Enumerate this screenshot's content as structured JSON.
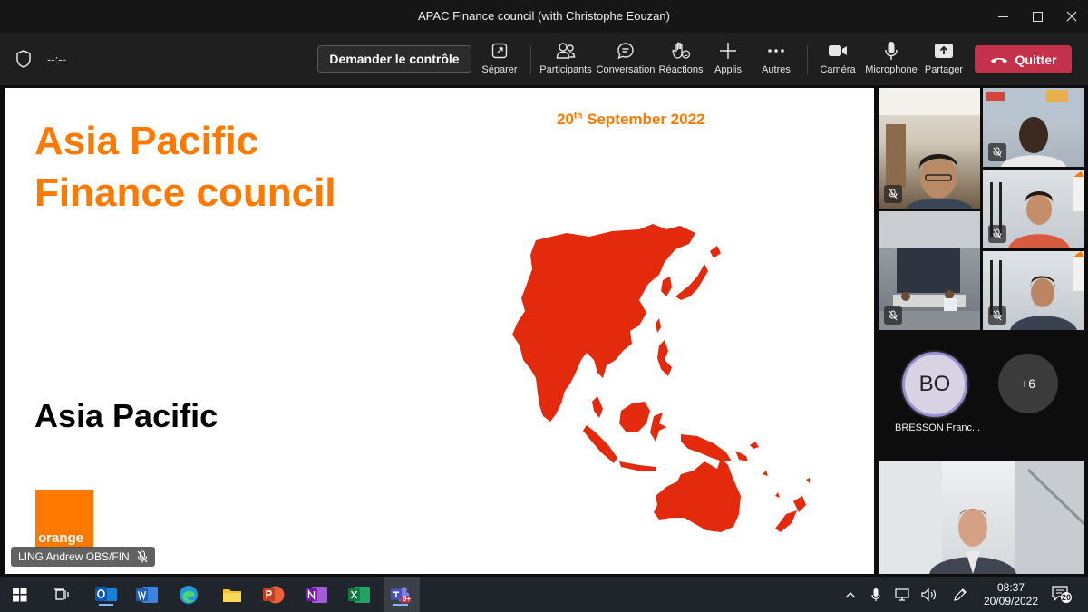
{
  "window": {
    "title": "APAC Finance council (with Christophe Eouzan)"
  },
  "toolbar": {
    "timer": "--:--",
    "control_label": "Demander le contrôle",
    "items": [
      {
        "label": "Séparer",
        "icon": "popout-icon"
      },
      {
        "label": "Participants",
        "icon": "people-icon"
      },
      {
        "label": "Conversation",
        "icon": "chat-icon"
      },
      {
        "label": "Réactions",
        "icon": "raise-hand-icon"
      },
      {
        "label": "Applis",
        "icon": "plus-icon"
      },
      {
        "label": "Autres",
        "icon": "more-icon"
      },
      {
        "label": "Caméra",
        "icon": "camera-icon"
      },
      {
        "label": "Microphone",
        "icon": "microphone-icon"
      },
      {
        "label": "Partager",
        "icon": "share-icon"
      }
    ],
    "quit_label": "Quitter",
    "quit_color": "#c4314b"
  },
  "slide": {
    "title_line1": "Asia Pacific",
    "title_line2": "Finance council",
    "date_day": "20",
    "date_suffix": "th",
    "date_rest": " September 2022",
    "subtitle": "Asia Pacific",
    "logo_text": "orange",
    "accent": "#ff7900",
    "map_color": "#e32a0c"
  },
  "presenter": {
    "name": "LING Andrew OBS/FIN"
  },
  "participants": {
    "avatar_initials": "BO",
    "avatar_name": "BRESSON Franc...",
    "more_count": "+6"
  },
  "taskbar": {
    "apps": [
      "windows-start-icon",
      "task-view-icon",
      "outlook-icon",
      "word-icon",
      "edge-icon",
      "file-explorer-icon",
      "powerpoint-icon",
      "onenote-icon",
      "excel-icon",
      "teams-icon"
    ],
    "teams_badge": "9+",
    "time": "08:37",
    "date": "20/09/2022",
    "notification_count": "20"
  }
}
